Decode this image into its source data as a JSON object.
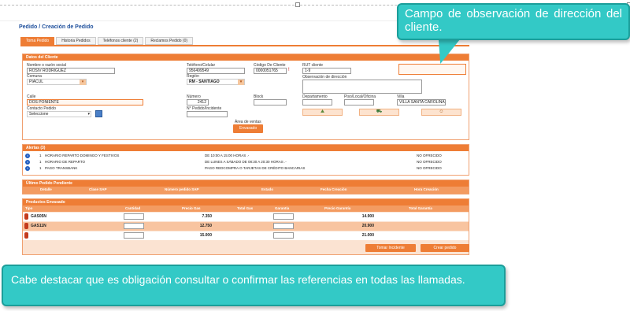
{
  "page_title": "Pedido / Creación de Pedido",
  "tabs": [
    "Toma Pedido",
    "Historia Pedidos",
    "Teléfonos cliente (2)",
    "Reclamos Pedido (0)"
  ],
  "client": {
    "header": "Datos del Cliente",
    "name_label": "Nombre o razón social",
    "name_value": "ROSIV RODRIGUEZ",
    "phone_label": "Teléfono/Celular",
    "phone_value": "956499549",
    "client_code_label": "Código De Cliente",
    "client_code_value": "0000051765",
    "rut_label": "RUT cliente",
    "rut_value": "1-9",
    "comuna_label": "Comuna",
    "comuna_value": "PIACUL",
    "region_label": "Región",
    "region_value": "RM - SANTIAGO",
    "obs_label": "Observación de dirección",
    "street_label": "Calle",
    "street_value": "DOS PONIENTE",
    "number_label": "Número",
    "number_value": "2412",
    "block_label": "Block",
    "dept_label": "Departamento",
    "floor_label": "Piso/Local/Oficina",
    "villa_label": "Villa",
    "villa_value": "VILLA SANTA CAROLINA",
    "contact_label": "Contacto Pedido",
    "contact_value": "Seleccione",
    "order_no_label": "N° Pedido/Incidente",
    "sales_area_label": "Área de ventas",
    "sales_area_button": "Envasado"
  },
  "alerts": {
    "header": "Alertas (3)",
    "rows": [
      {
        "count": "1",
        "name": "HORARIO REPARTO DOMINGO Y FESTIVOS",
        "detail": "DE 10:00 A 15:00 HORAS .-",
        "status": "NO OFRECIDO"
      },
      {
        "count": "1",
        "name": "HORARIO DE REPARTO",
        "detail": "DE LUNES A SÁBADO DE 08:30 A 20:30 HORAS .-",
        "status": "NO OFRECIDO"
      },
      {
        "count": "1",
        "name": "PAGO TRANSBANK",
        "detail": "PAGO REDCOMPRA O TARJETAS DE CRÉDITO BANCARIAS",
        "status": "NO OFRECIDO"
      }
    ]
  },
  "last_order": {
    "header": "Último Pedido Pendiente",
    "columns": [
      "Detalle",
      "Clase SAP",
      "Número pedido SAP",
      "Estado",
      "Fecha Creación",
      "Hora Creación"
    ]
  },
  "products": {
    "header": "Productos Envasado",
    "columns": [
      "Tipo",
      "Cantidad",
      "Precio Gas",
      "Total Gas",
      "Garantía",
      "Precio Garantía",
      "Total Garantía"
    ],
    "rows": [
      {
        "name": "GAS05N",
        "price": "7.350",
        "guarantee_price": "14.900"
      },
      {
        "name": "GAS11N",
        "price": "12.750",
        "guarantee_price": "20.900"
      },
      {
        "name": "",
        "price": "15.000",
        "guarantee_price": "21.000"
      }
    ]
  },
  "buttons": {
    "incident": "Tomar Incidente",
    "create": "Crear pedido"
  },
  "callouts": {
    "top": "Campo de observación de dirección del cliente.",
    "bottom": "Cabe destacar que es obligación consultar o confirmar las referencias en todas las llamadas."
  },
  "icons": {
    "calendar": "calendar-icon",
    "map": "map-icon",
    "truck": "truck-icon",
    "person": "person-icon",
    "info": "info-icon",
    "gas": "gas-cylinder-icon"
  },
  "colors": {
    "accent": "#ee7d35",
    "callout": "#33c9c6",
    "title": "#1e4f9c"
  }
}
